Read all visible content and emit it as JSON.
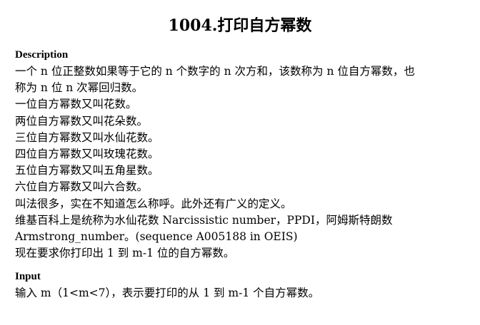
{
  "problem": {
    "title": "1004.打印自方幂数"
  },
  "description": {
    "heading": "Description",
    "lines": [
      "一个 n 位正整数如果等于它的 n 个数字的 n 次方和，该数称为 n 位自方幂数，也",
      "称为 n 位 n 次幂回归数。",
      "一位自方幂数又叫花数。",
      "两位自方幂数又叫花朵数。",
      "三位自方幂数又叫水仙花数。",
      "四位自方幂数又叫玫瑰花数。",
      "五位自方幂数又叫五角星数。",
      "六位自方幂数又叫六合数。",
      "叫法很多，实在不知道怎么称呼。此外还有广义的定义。",
      "维基百科上是统称为水仙花数 Narcissistic number，PPDI，阿姆斯特朗数",
      "Armstrong_number。(sequence A005188 in OEIS)",
      "现在要求你打印出 1 到 m-1 位的自方幂数。"
    ]
  },
  "input": {
    "heading": "Input",
    "lines": [
      "输入 m（1<m<7），表示要打印的从 1 到 m-1 个自方幂数。"
    ]
  }
}
